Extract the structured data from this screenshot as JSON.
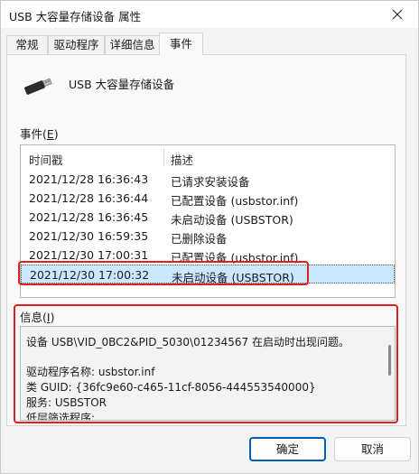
{
  "window": {
    "title": "USB 大容量存储设备 属性"
  },
  "tabs": [
    {
      "label": "常规"
    },
    {
      "label": "驱动程序"
    },
    {
      "label": "详细信息"
    },
    {
      "label": "事件",
      "active": true
    }
  ],
  "device": {
    "name": "USB 大容量存储设备",
    "icon": "usb-drive-icon"
  },
  "events": {
    "label_text": "事件(",
    "label_key": "E",
    "label_end": ")",
    "columns": {
      "time": "时间戳",
      "desc": "描述"
    },
    "rows": [
      {
        "time": "2021/12/28 16:36:43",
        "desc": "已请求安装设备"
      },
      {
        "time": "2021/12/28 16:36:44",
        "desc": "已配置设备 (usbstor.inf)"
      },
      {
        "time": "2021/12/28 16:36:45",
        "desc": "未启动设备 (USBSTOR)"
      },
      {
        "time": "2021/12/30 16:59:35",
        "desc": "已删除设备"
      },
      {
        "time": "2021/12/30 17:00:31",
        "desc": "已配置设备 (usbstor.inf)"
      },
      {
        "time": "2021/12/30 17:00:32",
        "desc": "未启动设备 (USBSTOR)",
        "selected": true
      }
    ]
  },
  "info": {
    "label_text": "信息(",
    "label_key": "I",
    "label_end": ")",
    "lines": [
      "设备 USB\\VID_0BC2&PID_5030\\01234567 在启动时出现问题。",
      "",
      "驱动程序名称: usbstor.inf",
      "类 GUID: {36fc9e60-c465-11cf-8056-444553540000}",
      "服务: USBSTOR",
      "低层筛选程序:"
    ]
  },
  "buttons": {
    "ok": "确定",
    "cancel": "取消"
  },
  "colors": {
    "highlight": "#e01f1f",
    "selection": "#cce8ff",
    "accent": "#005fb8"
  }
}
